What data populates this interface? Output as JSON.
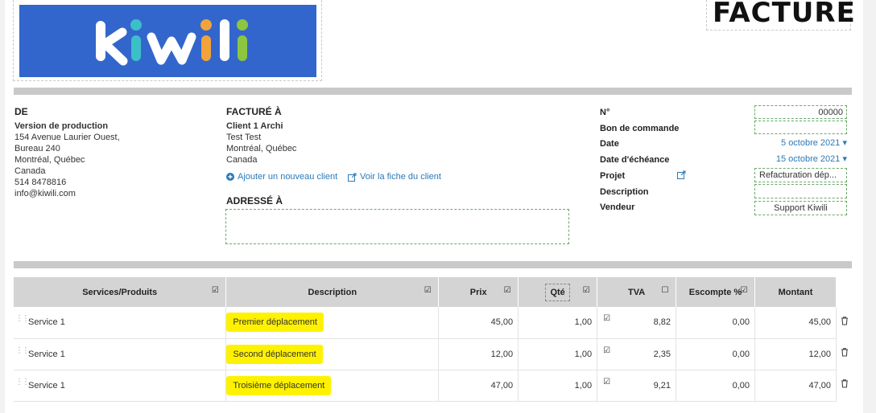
{
  "logo": {
    "text": "kiwili",
    "bg": "#3366cc"
  },
  "doc_title": "FACTURE",
  "from": {
    "heading": "DE",
    "name": "Version de production",
    "lines": [
      "154 Avenue Laurier Ouest,",
      "Bureau 240",
      "Montréal, Québec",
      "Canada",
      "514 8478816",
      "info@kiwili.com"
    ]
  },
  "billed_to": {
    "heading": "FACTURÉ À",
    "name": "Client 1 Archi",
    "lines": [
      "Test Test",
      "Montréal, Québec",
      "Canada"
    ],
    "add_client": "Ajouter un nouveau client",
    "view_client": "Voir la fiche du client"
  },
  "addressed_to": {
    "heading": "ADRESSÉ À"
  },
  "meta": {
    "number_label": "N°",
    "number_value": "00000",
    "po_label": "Bon de commande",
    "date_label": "Date",
    "date_value": "5 octobre 2021",
    "due_label": "Date d'échéance",
    "due_value": "15 octobre 2021",
    "project_label": "Projet",
    "project_value": "Refacturation dép...",
    "description_label": "Description",
    "seller_label": "Vendeur",
    "seller_value": "Support Kiwili"
  },
  "table": {
    "headers": {
      "product": "Services/Produits",
      "description": "Description",
      "price": "Prix",
      "qty": "Qté",
      "tax": "TVA",
      "discount": "Escompte %",
      "amount": "Montant"
    },
    "rows": [
      {
        "product": "Service 1",
        "description": "Premier déplacement",
        "price": "45,00",
        "qty": "1,00",
        "tax": "8,82",
        "discount": "0,00",
        "amount": "45,00"
      },
      {
        "product": "Service 1",
        "description": "Second déplacement",
        "price": "12,00",
        "qty": "1,00",
        "tax": "2,35",
        "discount": "0,00",
        "amount": "12,00"
      },
      {
        "product": "Service 1",
        "description": "Troisième déplacement",
        "price": "47,00",
        "qty": "1,00",
        "tax": "9,21",
        "discount": "0,00",
        "amount": "47,00"
      }
    ]
  },
  "colors": {
    "accent": "#2a7ab8",
    "highlight": "#fff200",
    "bar": "#c9c9c9"
  }
}
